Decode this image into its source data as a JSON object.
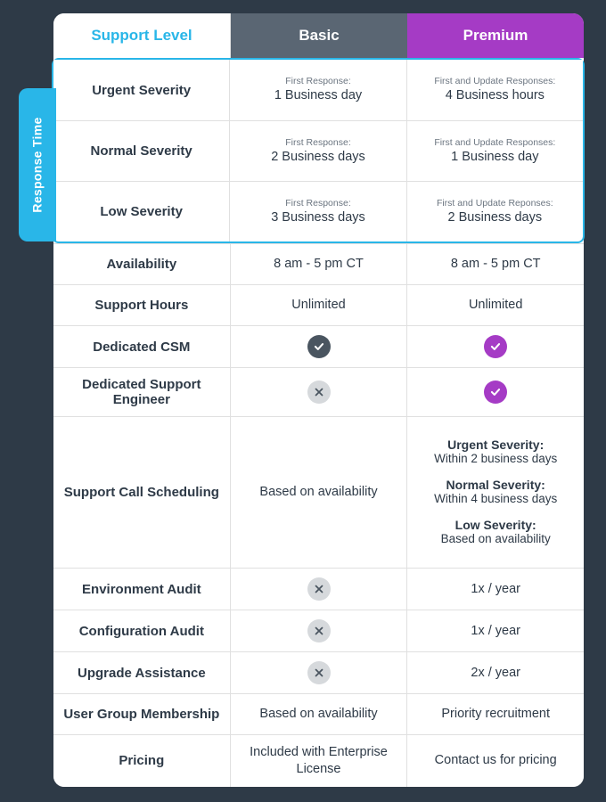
{
  "colors": {
    "accent": "#29b6e8",
    "premium": "#a53bc5",
    "basicHeader": "#5a6673",
    "dark": "#2e3a47"
  },
  "sideTab": "Response Time",
  "headers": {
    "level": "Support Level",
    "basic": "Basic",
    "premium": "Premium"
  },
  "responseRows": [
    {
      "label": "Urgent Severity",
      "basicCaption": "First Response:",
      "basicValue": "1 Business day",
      "premiumCaption": "First and Update Responses:",
      "premiumValue": "4 Business hours"
    },
    {
      "label": "Normal Severity",
      "basicCaption": "First Response:",
      "basicValue": "2 Business days",
      "premiumCaption": "First and Update Responses:",
      "premiumValue": "1 Business day"
    },
    {
      "label": "Low Severity",
      "basicCaption": "First Response:",
      "basicValue": "3 Business days",
      "premiumCaption": "First and Update Reponses:",
      "premiumValue": "2 Business days"
    }
  ],
  "simpleRows": {
    "availability": {
      "label": "Availability",
      "basic": "8 am - 5 pm CT",
      "premium": "8 am - 5 pm CT"
    },
    "hours": {
      "label": "Support Hours",
      "basic": "Unlimited",
      "premium": "Unlimited"
    },
    "csm": {
      "label": "Dedicated CSM"
    },
    "engineer": {
      "label": "Dedicated Support Engineer"
    },
    "scheduling": {
      "label": "Support Call Scheduling",
      "basic": "Based on availability",
      "premium": [
        {
          "title": "Urgent Severity:",
          "sub": "Within 2 business days"
        },
        {
          "title": "Normal Severity:",
          "sub": "Within 4 business days"
        },
        {
          "title": "Low Severity:",
          "sub": "Based on availability"
        }
      ]
    },
    "envAudit": {
      "label": "Environment Audit",
      "premium": "1x / year"
    },
    "confAudit": {
      "label": "Configuration Audit",
      "premium": "1x / year"
    },
    "upgrade": {
      "label": "Upgrade Assistance",
      "premium": "2x / year"
    },
    "userGroup": {
      "label": "User Group Membership",
      "basic": "Based on availability",
      "premium": "Priority recruitment"
    },
    "pricing": {
      "label": "Pricing",
      "basic": "Included with Enterprise License",
      "premium": "Contact us for pricing"
    }
  }
}
